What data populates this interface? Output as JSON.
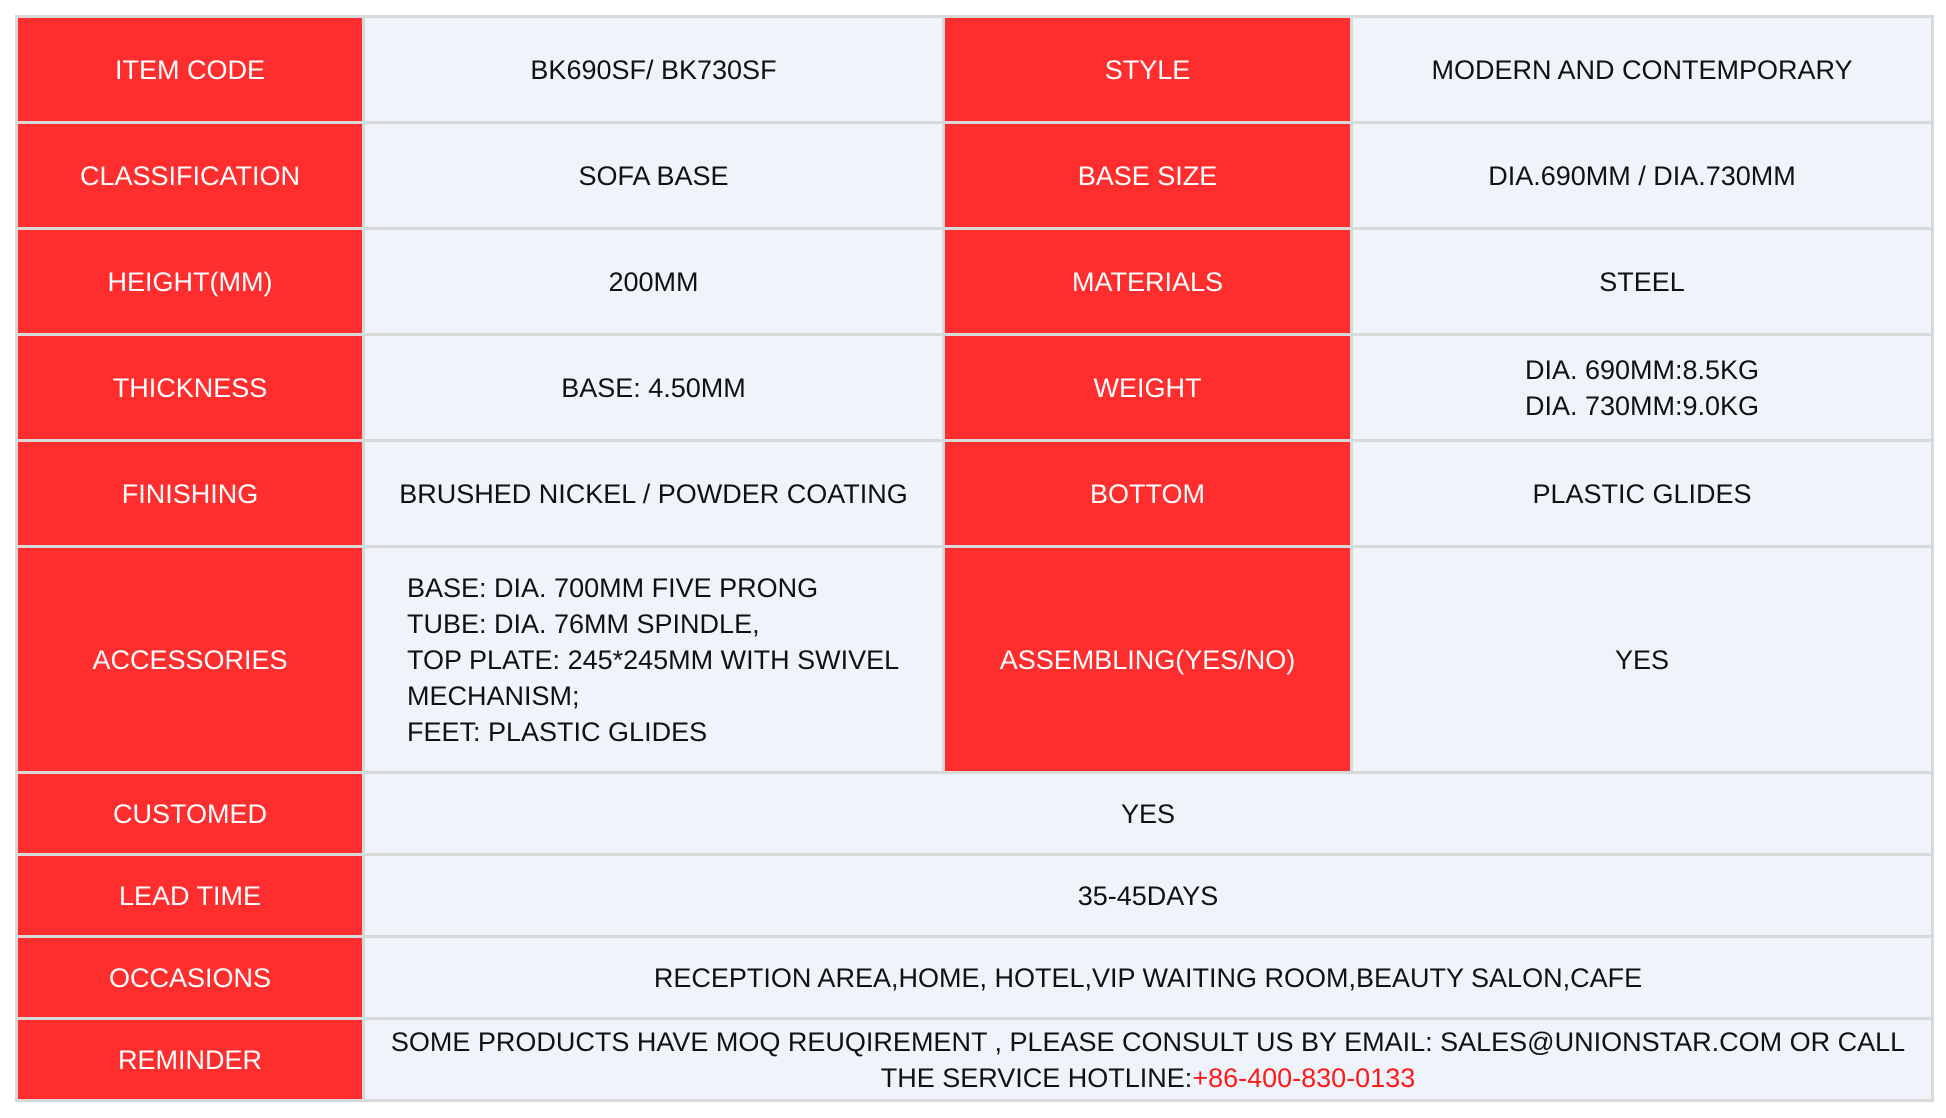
{
  "rows": {
    "item_code": {
      "label": "ITEM CODE",
      "value": "BK690SF/ BK730SF"
    },
    "style": {
      "label": "STYLE",
      "value": "MODERN AND CONTEMPORARY"
    },
    "classification": {
      "label": "CLASSIFICATION",
      "value": "SOFA BASE"
    },
    "base_size": {
      "label": "BASE SIZE",
      "value": "DIA.690MM / DIA.730MM"
    },
    "height": {
      "label": "HEIGHT(MM)",
      "value": "200MM"
    },
    "materials": {
      "label": "MATERIALS",
      "value": "STEEL"
    },
    "thickness": {
      "label": "THICKNESS",
      "value": "BASE: 4.50MM"
    },
    "weight": {
      "label": "WEIGHT",
      "lines": [
        "DIA. 690MM:8.5KG",
        "DIA. 730MM:9.0KG"
      ]
    },
    "finishing": {
      "label": "FINISHING",
      "value": "BRUSHED NICKEL / POWDER COATING"
    },
    "bottom": {
      "label": "BOTTOM",
      "value": "PLASTIC GLIDES"
    },
    "accessories": {
      "label": "ACCESSORIES",
      "lines": [
        "BASE: DIA. 700MM FIVE PRONG",
        "TUBE: DIA. 76MM SPINDLE,",
        "TOP PLATE: 245*245MM WITH SWIVEL",
        "MECHANISM;",
        "FEET: PLASTIC GLIDES"
      ]
    },
    "assembling": {
      "label": "ASSEMBLING(YES/NO)",
      "value": "YES"
    },
    "customed": {
      "label": "CUSTOMED",
      "value": "YES"
    },
    "lead_time": {
      "label": "LEAD TIME",
      "value": "35-45DAYS"
    },
    "occasions": {
      "label": "OCCASIONS",
      "value": "RECEPTION AREA,HOME, HOTEL,VIP WAITING ROOM,BEAUTY SALON,CAFE"
    },
    "reminder": {
      "label": "REMINDER",
      "line1": "SOME PRODUCTS HAVE MOQ REUQIREMENT , PLEASE CONSULT US BY EMAIL: SALES@UNIONSTAR.COM OR CALL",
      "line2_prefix": "THE SERVICE HOTLINE:",
      "hotline": "+86-400-830-0133"
    }
  },
  "colors": {
    "label_bg": "#ff2e2e",
    "value_bg": "#eef4fa",
    "border": "#d9d9d9",
    "hotline": "#ff1a1a"
  }
}
